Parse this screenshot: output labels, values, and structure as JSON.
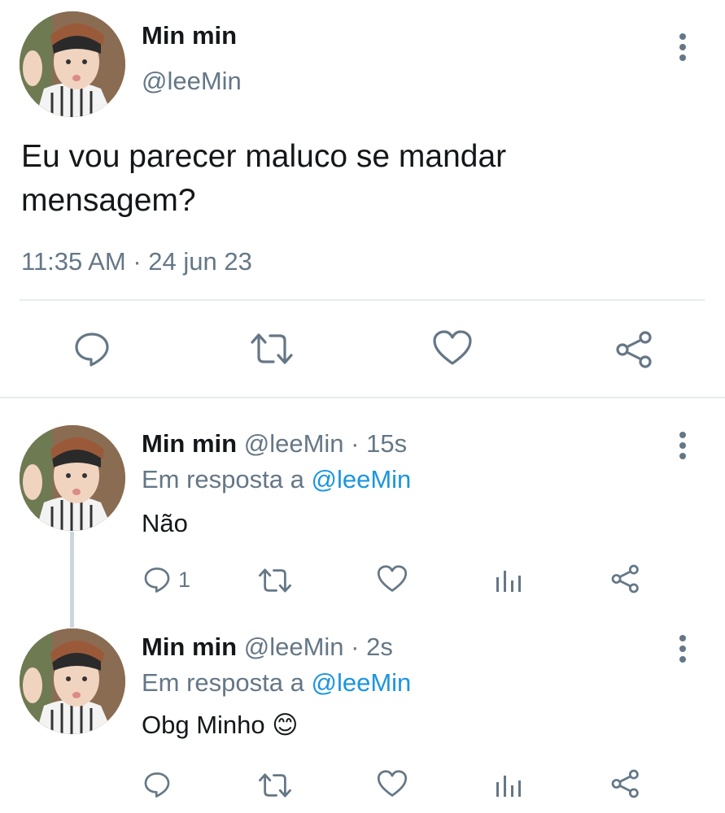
{
  "main_tweet": {
    "display_name": "Min min",
    "handle": "@leeMin",
    "text_line1": "Eu vou parecer maluco se mandar",
    "text_line2": "mensagem?",
    "time": "11:35 AM",
    "separator": "·",
    "date": "24 jun 23"
  },
  "replies": [
    {
      "display_name": "Min min",
      "handle": "@leeMin",
      "separator": "·",
      "age": "15s",
      "in_reply_prefix": "Em resposta a",
      "in_reply_handle": "@leeMin",
      "text": "Não",
      "reply_count": "1"
    },
    {
      "display_name": "Min min",
      "handle": "@leeMin",
      "separator": "·",
      "age": "2s",
      "in_reply_prefix": "Em resposta a",
      "in_reply_handle": "@leeMin",
      "text": "Obg Minho",
      "emoji": "😊"
    }
  ],
  "icons": {
    "reply": "speech-bubble-icon",
    "retweet": "retweet-arrows-icon",
    "like": "heart-icon",
    "analytics": "bar-chart-icon",
    "share": "share-nodes-icon",
    "more": "vertical-dots-icon"
  },
  "colors": {
    "text": "#14171a",
    "secondary": "#657786",
    "link": "#1b95e0",
    "divider": "#e6ecf0"
  }
}
